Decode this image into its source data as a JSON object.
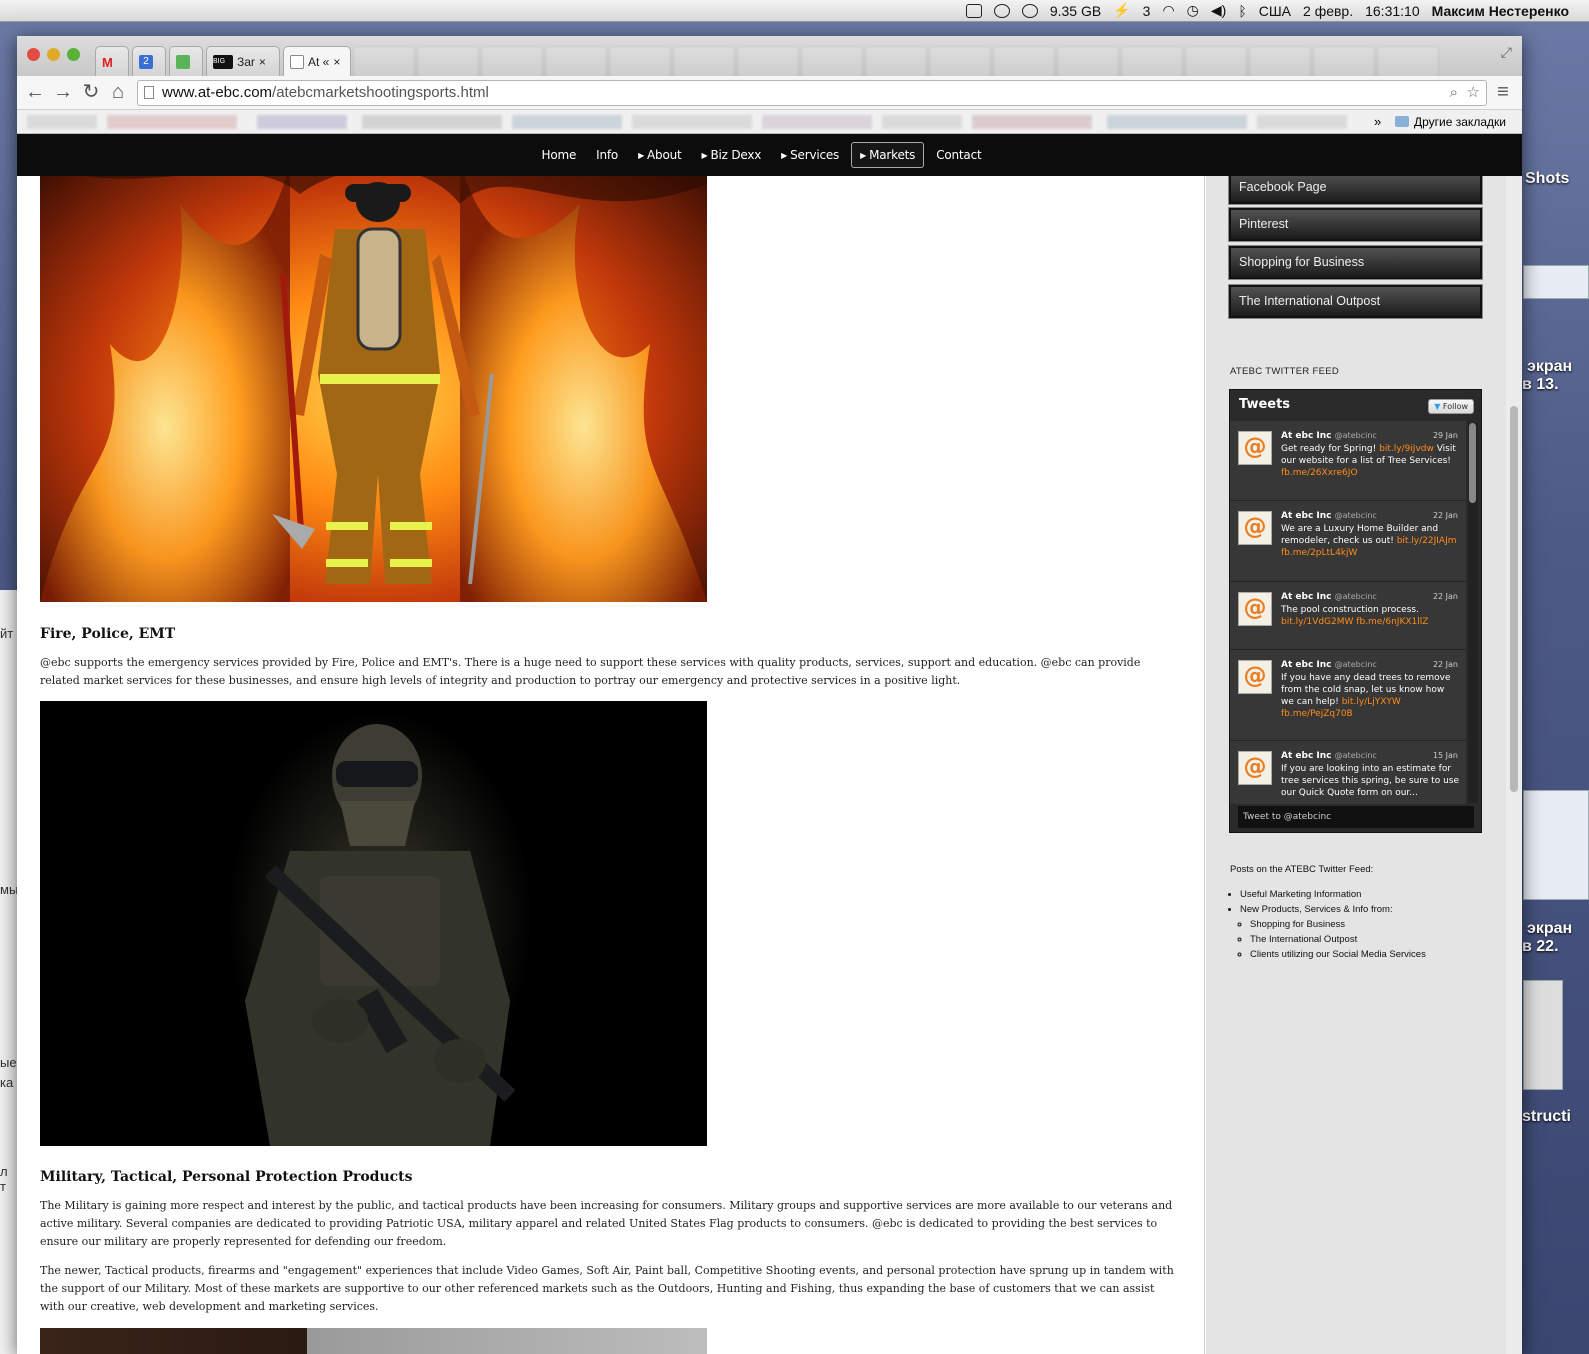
{
  "menubar": {
    "disk": "9.35 GB",
    "input_count": "3",
    "locale": "США",
    "date": "2 февр.",
    "time": "16:31:10",
    "user": "Максим Нестеренко"
  },
  "desktop": {
    "labels": [
      "Shots",
      "экран",
      "в 13.",
      "экран",
      "в 22.",
      "structi"
    ],
    "peek_labels": [
      "йт",
      "мы",
      "ые",
      "ка",
      "л т"
    ]
  },
  "browser": {
    "tabs": [
      {
        "label": "Зar"
      },
      {
        "label": "At «"
      }
    ],
    "tab_icons": {
      "gmail": "M",
      "calendar": "2",
      "big": "BIG"
    },
    "url_host": "www.at-ebc.com",
    "url_path": "/atebcmarketshootingsports.html",
    "bookmarks_other": "Другие закладки",
    "bookmarks_chevron": "»"
  },
  "nav": {
    "items": [
      "Home",
      "Info",
      "About",
      "Biz Dexx",
      "Services",
      "Markets",
      "Contact"
    ],
    "active": "Markets"
  },
  "content": {
    "sections": [
      {
        "heading": "Fire, Police, EMT",
        "paragraphs": [
          "@ebc supports the emergency services provided by Fire, Police and EMT's. There is a huge need to support these services with quality products, services, support and education. @ebc can provide related market services for these businesses, and ensure high levels of integrity and production to portray our emergency and protective services in a positive light."
        ]
      },
      {
        "heading": "Military, Tactical, Personal Protection Products",
        "paragraphs": [
          "The Military is gaining more respect and interest by the public, and tactical products have been increasing for consumers. Military groups and supportive services are more available to our veterans and active military. Several companies are dedicated to providing Patriotic USA, military apparel and related United States Flag products to consumers. @ebc is dedicated to providing the best services to ensure our military are properly represented for defending our freedom.",
          "The newer, Tactical products, firearms and \"engagement\" experiences that include Video Games, Soft Air, Paint ball, Competitive Shooting events, and personal protection have sprung up in tandem with the support of our Military. Most of these markets are supportive to our other referenced markets such as the Outdoors, Hunting and Fishing, thus expanding the base of customers that we can assist with our creative, web development and marketing services."
        ]
      }
    ]
  },
  "sidebar": {
    "buttons": [
      "Facebook Page",
      "Pinterest",
      "Shopping for Business",
      "The International Outpost"
    ],
    "feed_label": "ATEBC TWITTER FEED",
    "twitter": {
      "title": "Tweets",
      "follow": "Follow",
      "avatar_text": "@",
      "tweets": [
        {
          "name": "At ebc Inc",
          "handle": "@atebcinc",
          "date": "29 Jan",
          "text": "Get ready for Spring! ",
          "links": [
            "bit.ly/9iJvdw"
          ],
          "text2": " Visit our website for a list of Tree Services! ",
          "links2": [
            "fb.me/26Xxre6JO"
          ]
        },
        {
          "name": "At ebc Inc",
          "handle": "@atebcinc",
          "date": "22 Jan",
          "text": "We are a Luxury Home Builder and remodeler, check us out! ",
          "links": [
            "bit.ly/22JIAJm fb.me/2pLtL4kjW"
          ],
          "text2": "",
          "links2": [
            ""
          ]
        },
        {
          "name": "At ebc Inc",
          "handle": "@atebcinc",
          "date": "22 Jan",
          "text": "The pool construction process. ",
          "links": [
            "bit.ly/1VdG2MW fb.me/6nJKX1llZ"
          ],
          "text2": "",
          "links2": [
            ""
          ]
        },
        {
          "name": "At ebc Inc",
          "handle": "@atebcinc",
          "date": "22 Jan",
          "text": "If you have any dead trees to remove from the cold snap, let us know how we can help! ",
          "links": [
            "bit.ly/LjYXYW fb.me/PejZq70B"
          ],
          "text2": "",
          "links2": [
            ""
          ]
        },
        {
          "name": "At ebc Inc",
          "handle": "@atebcinc",
          "date": "15 Jan",
          "text": "If you are looking into an estimate for tree services this spring, be sure to use our Quick Quote form on our...",
          "links": [
            ""
          ],
          "text2": "",
          "links2": [
            ""
          ]
        }
      ],
      "compose": "Tweet to @atebcinc"
    },
    "posts_title": "Posts on the ATEBC Twitter Feed:",
    "posts": [
      "Useful Marketing Information",
      "New Products, Services & Info from:"
    ],
    "subposts": [
      "Shopping for Business",
      "The International Outpost",
      "Clients utilizing our Social Media Services"
    ]
  },
  "colors": {
    "accent": "#ff8c1a",
    "nav_bg": "#0c0c0c",
    "sidebar_bg": "#e4e4e4"
  }
}
